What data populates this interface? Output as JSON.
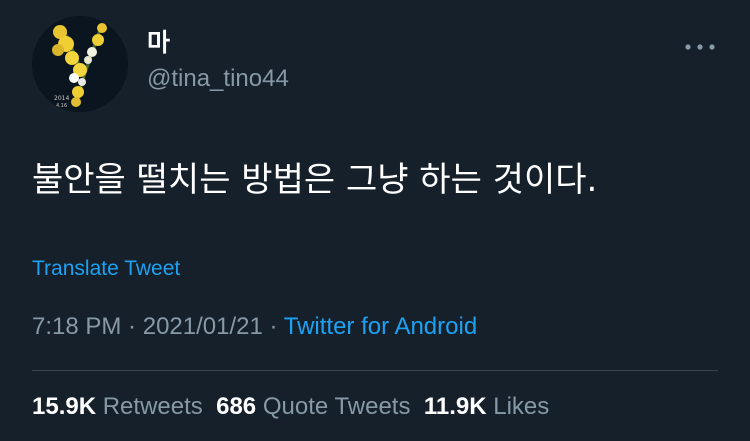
{
  "user": {
    "display_name": "마",
    "handle": "@tina_tino44",
    "avatar_text_line1": "2014",
    "avatar_text_line2": "4.16"
  },
  "tweet": {
    "text": "불안을 떨치는 방법은 그냥 하는 것이다.",
    "translate_label": "Translate Tweet",
    "time": "7:18 PM",
    "separator": " · ",
    "date": "2021/01/21",
    "source": "Twitter for Android"
  },
  "stats": {
    "retweets_count": "15.9K",
    "retweets_label": "Retweets",
    "quote_count": "686",
    "quote_label": "Quote Tweets",
    "likes_count": "11.9K",
    "likes_label": "Likes"
  },
  "icons": {
    "more": "more-horizontal-icon"
  },
  "colors": {
    "background": "#15202b",
    "accent": "#1da1f2",
    "secondary_text": "#8899a6",
    "divider": "#38444d"
  }
}
